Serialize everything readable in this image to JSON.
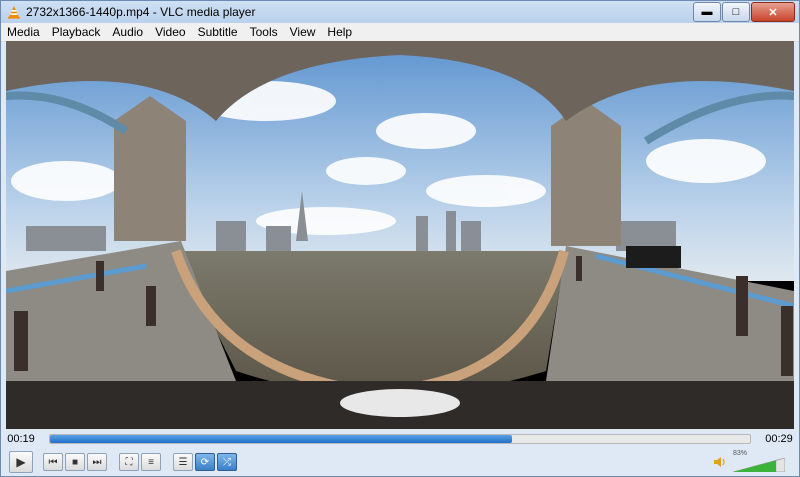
{
  "window": {
    "title": "2732x1366-1440p.mp4 - VLC media player"
  },
  "menu": [
    "Media",
    "Playback",
    "Audio",
    "Video",
    "Subtitle",
    "Tools",
    "View",
    "Help"
  ],
  "seek": {
    "current": "00:19",
    "total": "00:29",
    "progress": 0.66
  },
  "volume": {
    "percent_label": "83%",
    "level": 0.83
  },
  "colors": {
    "accent": "#1f6fc9",
    "sky": "#6fa3d8",
    "river": "#6f6a5a"
  },
  "icons": [
    "vlc-cone-icon",
    "minimize-icon",
    "maximize-icon",
    "close-icon",
    "play-icon",
    "previous-icon",
    "stop-icon",
    "next-icon",
    "fullscreen-icon",
    "extended-settings-icon",
    "playlist-icon",
    "loop-icon",
    "shuffle-icon",
    "speaker-icon"
  ]
}
